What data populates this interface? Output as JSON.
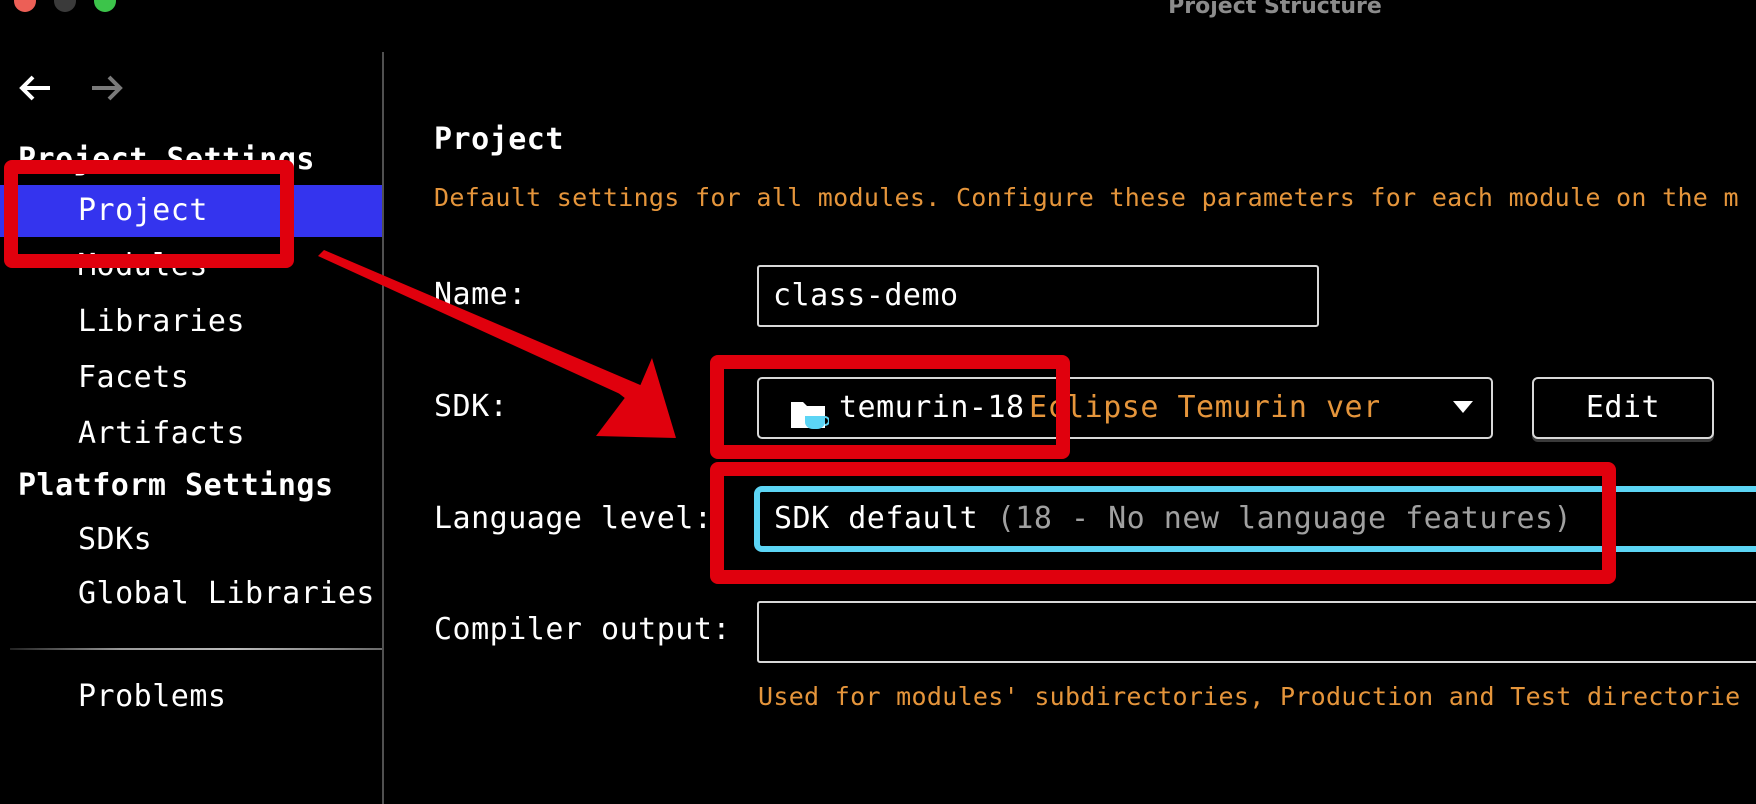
{
  "window": {
    "title": "Project Structure"
  },
  "sidebar": {
    "project_settings_header": "Project Settings",
    "project_items": [
      {
        "label": "Project"
      },
      {
        "label": "Modules"
      },
      {
        "label": "Libraries"
      },
      {
        "label": "Facets"
      },
      {
        "label": "Artifacts"
      }
    ],
    "platform_settings_header": "Platform Settings",
    "platform_items": [
      {
        "label": "SDKs"
      },
      {
        "label": "Global Libraries"
      }
    ],
    "problems_label": "Problems",
    "selected": "Project"
  },
  "content": {
    "title": "Project",
    "description": "Default settings for all modules. Configure these parameters for each module on the m",
    "name_label": "Name:",
    "name_value": "class-demo",
    "sdk_label": "SDK:",
    "sdk_name": "temurin-18",
    "sdk_description": "Eclipse Temurin vers",
    "edit_label": "Edit",
    "language_label": "Language level:",
    "language_value": "SDK default",
    "language_detail": "(18 - No new language features)",
    "compiler_label": "Compiler output:",
    "compiler_value": "",
    "compiler_hint": "Used for modules' subdirectories, Production and Test directorie"
  },
  "colors": {
    "background": "#000000",
    "selection": "#3434ee",
    "hint_orange": "#e5953b",
    "focus_cyan": "#5cd5f5",
    "annotation_red": "#e0000d"
  },
  "icons": {
    "back": "arrow-left-icon",
    "forward": "arrow-right-icon",
    "sdk": "sdk-folder-cup-icon",
    "dropdown": "chevron-down-icon"
  }
}
